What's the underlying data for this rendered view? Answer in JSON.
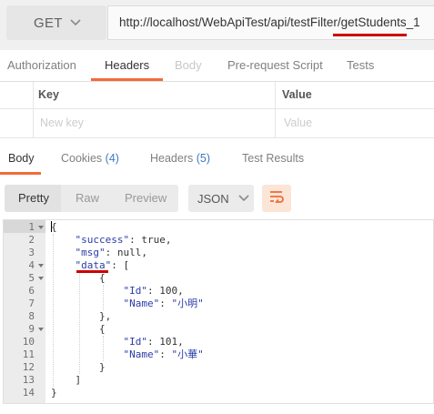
{
  "request": {
    "method": "GET",
    "url": "http://localhost/WebApiTest/api/testFilter/getStudents_1"
  },
  "request_tabs": [
    {
      "label": "Authorization",
      "state": "normal"
    },
    {
      "label": "Headers",
      "state": "active"
    },
    {
      "label": "Body",
      "state": "disabled"
    },
    {
      "label": "Pre-request Script",
      "state": "normal"
    },
    {
      "label": "Tests",
      "state": "normal"
    }
  ],
  "params_table": {
    "key_header": "Key",
    "value_header": "Value",
    "key_placeholder": "New key",
    "value_placeholder": "Value"
  },
  "response_tabs": {
    "body": "Body",
    "cookies": "Cookies",
    "cookies_count": "(4)",
    "headers": "Headers",
    "headers_count": "(5)",
    "test_results": "Test Results"
  },
  "response_toolbar": {
    "views": [
      "Pretty",
      "Raw",
      "Preview"
    ],
    "active_view": "Pretty",
    "format": "JSON",
    "wrap_icon": "wrap-lines-icon"
  },
  "code": {
    "line_numbers": [
      "1",
      "2",
      "3",
      "4",
      "5",
      "6",
      "7",
      "8",
      "9",
      "10",
      "11",
      "12",
      "13",
      "14"
    ],
    "foldable_lines": [
      1,
      4,
      5,
      9
    ]
  },
  "annotations": {
    "accent_color": "#f26b3a",
    "highlight_color": "#cc0000",
    "link_color": "#3d7ac2"
  }
}
